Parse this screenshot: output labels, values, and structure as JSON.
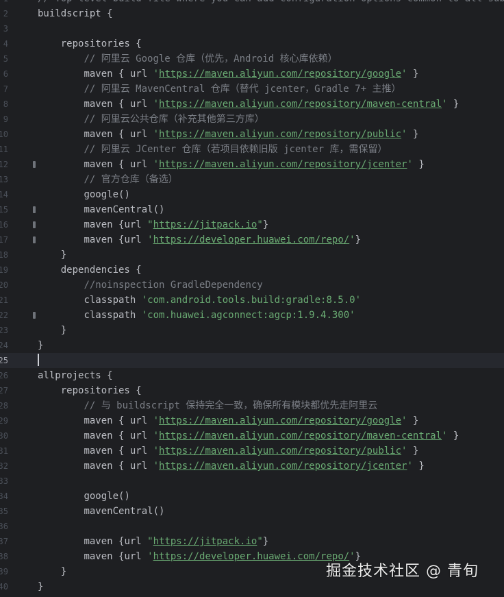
{
  "editor": {
    "language": "groovy",
    "current_line": "25",
    "lines": [
      {
        "num": "1",
        "indent": 0,
        "fold": false,
        "tokens": [
          {
            "t": "comment",
            "v": "// Top-level build file where you can add configuration options common to all sub-pro"
          }
        ]
      },
      {
        "num": "2",
        "indent": 0,
        "fold": false,
        "tokens": [
          {
            "t": "text",
            "v": "buildscript {"
          }
        ]
      },
      {
        "num": "3",
        "indent": 0,
        "fold": false,
        "tokens": []
      },
      {
        "num": "4",
        "indent": 1,
        "fold": false,
        "tokens": [
          {
            "t": "text",
            "v": "repositories {"
          }
        ]
      },
      {
        "num": "5",
        "indent": 2,
        "fold": false,
        "tokens": [
          {
            "t": "comment",
            "v": "// 阿里云 Google 仓库（优先，Android 核心库依赖）"
          }
        ]
      },
      {
        "num": "6",
        "indent": 2,
        "fold": false,
        "tokens": [
          {
            "t": "text",
            "v": "maven { url "
          },
          {
            "t": "str",
            "v": "'"
          },
          {
            "t": "url",
            "v": "https://maven.aliyun.com/repository/google"
          },
          {
            "t": "str",
            "v": "'"
          },
          {
            "t": "text",
            "v": " }"
          }
        ]
      },
      {
        "num": "7",
        "indent": 2,
        "fold": false,
        "tokens": [
          {
            "t": "comment",
            "v": "// 阿里云 MavenCentral 仓库（替代 jcenter，Gradle 7+ 主推）"
          }
        ]
      },
      {
        "num": "8",
        "indent": 2,
        "fold": false,
        "tokens": [
          {
            "t": "text",
            "v": "maven { url "
          },
          {
            "t": "str",
            "v": "'"
          },
          {
            "t": "url",
            "v": "https://maven.aliyun.com/repository/maven-central"
          },
          {
            "t": "str",
            "v": "'"
          },
          {
            "t": "text",
            "v": " }"
          }
        ]
      },
      {
        "num": "9",
        "indent": 2,
        "fold": false,
        "tokens": [
          {
            "t": "comment",
            "v": "// 阿里云公共仓库（补充其他第三方库）"
          }
        ]
      },
      {
        "num": "10",
        "indent": 2,
        "fold": false,
        "tokens": [
          {
            "t": "text",
            "v": "maven { url "
          },
          {
            "t": "str",
            "v": "'"
          },
          {
            "t": "url",
            "v": "https://maven.aliyun.com/repository/public"
          },
          {
            "t": "str",
            "v": "'"
          },
          {
            "t": "text",
            "v": " }"
          }
        ]
      },
      {
        "num": "11",
        "indent": 2,
        "fold": false,
        "tokens": [
          {
            "t": "comment",
            "v": "// 阿里云 JCenter 仓库（若项目依赖旧版 jcenter 库，需保留）"
          }
        ]
      },
      {
        "num": "12",
        "indent": 2,
        "fold": true,
        "tokens": [
          {
            "t": "text",
            "v": "maven { url "
          },
          {
            "t": "str",
            "v": "'"
          },
          {
            "t": "url",
            "v": "https://maven.aliyun.com/repository/jcenter"
          },
          {
            "t": "str",
            "v": "'"
          },
          {
            "t": "text",
            "v": " }"
          }
        ]
      },
      {
        "num": "13",
        "indent": 2,
        "fold": false,
        "tokens": [
          {
            "t": "comment",
            "v": "// 官方仓库（备选）"
          }
        ]
      },
      {
        "num": "14",
        "indent": 2,
        "fold": false,
        "tokens": [
          {
            "t": "text",
            "v": "google()"
          }
        ]
      },
      {
        "num": "15",
        "indent": 2,
        "fold": true,
        "tokens": [
          {
            "t": "text",
            "v": "mavenCentral()"
          }
        ]
      },
      {
        "num": "16",
        "indent": 2,
        "fold": true,
        "tokens": [
          {
            "t": "text",
            "v": "maven {url "
          },
          {
            "t": "str",
            "v": "\""
          },
          {
            "t": "url",
            "v": "https://jitpack.io"
          },
          {
            "t": "str",
            "v": "\""
          },
          {
            "t": "text",
            "v": "}"
          }
        ]
      },
      {
        "num": "17",
        "indent": 2,
        "fold": true,
        "tokens": [
          {
            "t": "text",
            "v": "maven {url "
          },
          {
            "t": "str",
            "v": "'"
          },
          {
            "t": "url",
            "v": "https://developer.huawei.com/repo/"
          },
          {
            "t": "str",
            "v": "'"
          },
          {
            "t": "text",
            "v": "}"
          }
        ]
      },
      {
        "num": "18",
        "indent": 1,
        "fold": false,
        "tokens": [
          {
            "t": "text",
            "v": "}"
          }
        ]
      },
      {
        "num": "19",
        "indent": 1,
        "fold": false,
        "tokens": [
          {
            "t": "text",
            "v": "dependencies {"
          }
        ]
      },
      {
        "num": "20",
        "indent": 2,
        "fold": false,
        "tokens": [
          {
            "t": "comment",
            "v": "//noinspection GradleDependency"
          }
        ]
      },
      {
        "num": "21",
        "indent": 2,
        "fold": false,
        "tokens": [
          {
            "t": "text",
            "v": "classpath "
          },
          {
            "t": "str",
            "v": "'com.android.tools.build:gradle:8.5.0'"
          }
        ]
      },
      {
        "num": "22",
        "indent": 2,
        "fold": true,
        "tokens": [
          {
            "t": "text",
            "v": "classpath "
          },
          {
            "t": "str",
            "v": "'com.huawei.agconnect:agcp:1.9.4.300'"
          }
        ]
      },
      {
        "num": "23",
        "indent": 1,
        "fold": false,
        "tokens": [
          {
            "t": "text",
            "v": "}"
          }
        ]
      },
      {
        "num": "24",
        "indent": 0,
        "fold": false,
        "tokens": [
          {
            "t": "text",
            "v": "}"
          }
        ]
      },
      {
        "num": "25",
        "indent": 0,
        "fold": false,
        "caret": true,
        "tokens": []
      },
      {
        "num": "26",
        "indent": 0,
        "fold": false,
        "tokens": [
          {
            "t": "text",
            "v": "allprojects {"
          }
        ]
      },
      {
        "num": "27",
        "indent": 1,
        "fold": false,
        "tokens": [
          {
            "t": "text",
            "v": "repositories {"
          }
        ]
      },
      {
        "num": "28",
        "indent": 2,
        "fold": false,
        "tokens": [
          {
            "t": "comment",
            "v": "// 与 buildscript 保持完全一致，确保所有模块都优先走阿里云"
          }
        ]
      },
      {
        "num": "29",
        "indent": 2,
        "fold": false,
        "tokens": [
          {
            "t": "text",
            "v": "maven { url "
          },
          {
            "t": "str",
            "v": "'"
          },
          {
            "t": "url",
            "v": "https://maven.aliyun.com/repository/google"
          },
          {
            "t": "str",
            "v": "'"
          },
          {
            "t": "text",
            "v": " }"
          }
        ]
      },
      {
        "num": "30",
        "indent": 2,
        "fold": false,
        "tokens": [
          {
            "t": "text",
            "v": "maven { url "
          },
          {
            "t": "str",
            "v": "'"
          },
          {
            "t": "url",
            "v": "https://maven.aliyun.com/repository/maven-central"
          },
          {
            "t": "str",
            "v": "'"
          },
          {
            "t": "text",
            "v": " }"
          }
        ]
      },
      {
        "num": "31",
        "indent": 2,
        "fold": false,
        "tokens": [
          {
            "t": "text",
            "v": "maven { url "
          },
          {
            "t": "str",
            "v": "'"
          },
          {
            "t": "url",
            "v": "https://maven.aliyun.com/repository/public"
          },
          {
            "t": "str",
            "v": "'"
          },
          {
            "t": "text",
            "v": " }"
          }
        ]
      },
      {
        "num": "32",
        "indent": 2,
        "fold": false,
        "tokens": [
          {
            "t": "text",
            "v": "maven { url "
          },
          {
            "t": "str",
            "v": "'"
          },
          {
            "t": "url",
            "v": "https://maven.aliyun.com/repository/jcenter"
          },
          {
            "t": "str",
            "v": "'"
          },
          {
            "t": "text",
            "v": " }"
          }
        ]
      },
      {
        "num": "33",
        "indent": 0,
        "fold": false,
        "tokens": []
      },
      {
        "num": "34",
        "indent": 2,
        "fold": false,
        "tokens": [
          {
            "t": "text",
            "v": "google()"
          }
        ]
      },
      {
        "num": "35",
        "indent": 2,
        "fold": false,
        "tokens": [
          {
            "t": "text",
            "v": "mavenCentral()"
          }
        ]
      },
      {
        "num": "36",
        "indent": 0,
        "fold": false,
        "tokens": []
      },
      {
        "num": "37",
        "indent": 2,
        "fold": false,
        "tokens": [
          {
            "t": "text",
            "v": "maven {url "
          },
          {
            "t": "str",
            "v": "\""
          },
          {
            "t": "url",
            "v": "https://jitpack.io"
          },
          {
            "t": "str",
            "v": "\""
          },
          {
            "t": "text",
            "v": "}"
          }
        ]
      },
      {
        "num": "38",
        "indent": 2,
        "fold": false,
        "tokens": [
          {
            "t": "text",
            "v": "maven {url "
          },
          {
            "t": "str",
            "v": "'"
          },
          {
            "t": "url",
            "v": "https://developer.huawei.com/repo/"
          },
          {
            "t": "str",
            "v": "'"
          },
          {
            "t": "text",
            "v": "}"
          }
        ]
      },
      {
        "num": "39",
        "indent": 1,
        "fold": false,
        "tokens": [
          {
            "t": "text",
            "v": "}"
          }
        ]
      },
      {
        "num": "40",
        "indent": 0,
        "fold": false,
        "tokens": [
          {
            "t": "text",
            "v": "}"
          }
        ]
      }
    ]
  },
  "watermark": "掘金技术社区 @ 青旬",
  "colors": {
    "background": "#1e1f22",
    "text": "#bcbec4",
    "comment": "#7a7e85",
    "string": "#6aab73",
    "line_number": "#4b5059",
    "current_line_bg": "#26282e"
  }
}
